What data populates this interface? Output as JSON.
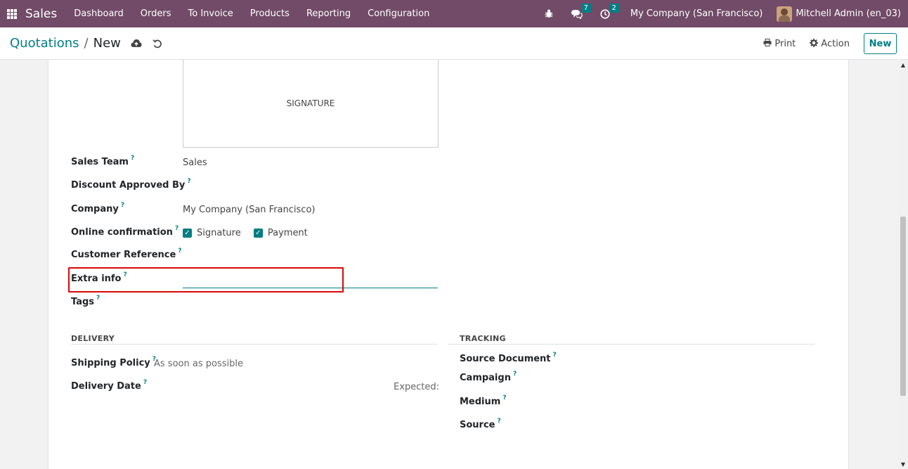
{
  "navbar": {
    "brand": "Sales",
    "menu": [
      "Dashboard",
      "Orders",
      "To Invoice",
      "Products",
      "Reporting",
      "Configuration"
    ],
    "messages_count": "7",
    "activities_count": "2",
    "company": "My Company (San Francisco)",
    "user": "Mitchell Admin (en_03)"
  },
  "control": {
    "breadcrumb_parent": "Quotations",
    "breadcrumb_separator": "/",
    "breadcrumb_current": "New",
    "print_label": "Print",
    "action_label": "Action",
    "new_label": "New"
  },
  "form": {
    "signature_placeholder": "SIGNATURE",
    "sales_team": {
      "label": "Sales Team",
      "value": "Sales"
    },
    "discount_approved_by": {
      "label": "Discount Approved By",
      "value": ""
    },
    "company": {
      "label": "Company",
      "value": "My Company (San Francisco)"
    },
    "online_confirmation": {
      "label": "Online confirmation",
      "signature": "Signature",
      "payment": "Payment"
    },
    "customer_reference": {
      "label": "Customer Reference",
      "value": ""
    },
    "extra_info": {
      "label": "Extra info",
      "value": ""
    },
    "tags": {
      "label": "Tags"
    },
    "help_mark": "?"
  },
  "delivery": {
    "title": "DELIVERY",
    "shipping_policy": {
      "label": "Shipping Policy",
      "value": "As soon as possible"
    },
    "delivery_date": {
      "label": "Delivery Date",
      "expected": "Expected:"
    }
  },
  "tracking": {
    "title": "TRACKING",
    "source_document": "Source Document",
    "campaign": "Campaign",
    "medium": "Medium",
    "source": "Source"
  },
  "colors": {
    "navbar": "#714b67",
    "accent": "#017e84",
    "highlight": "#d90808"
  }
}
